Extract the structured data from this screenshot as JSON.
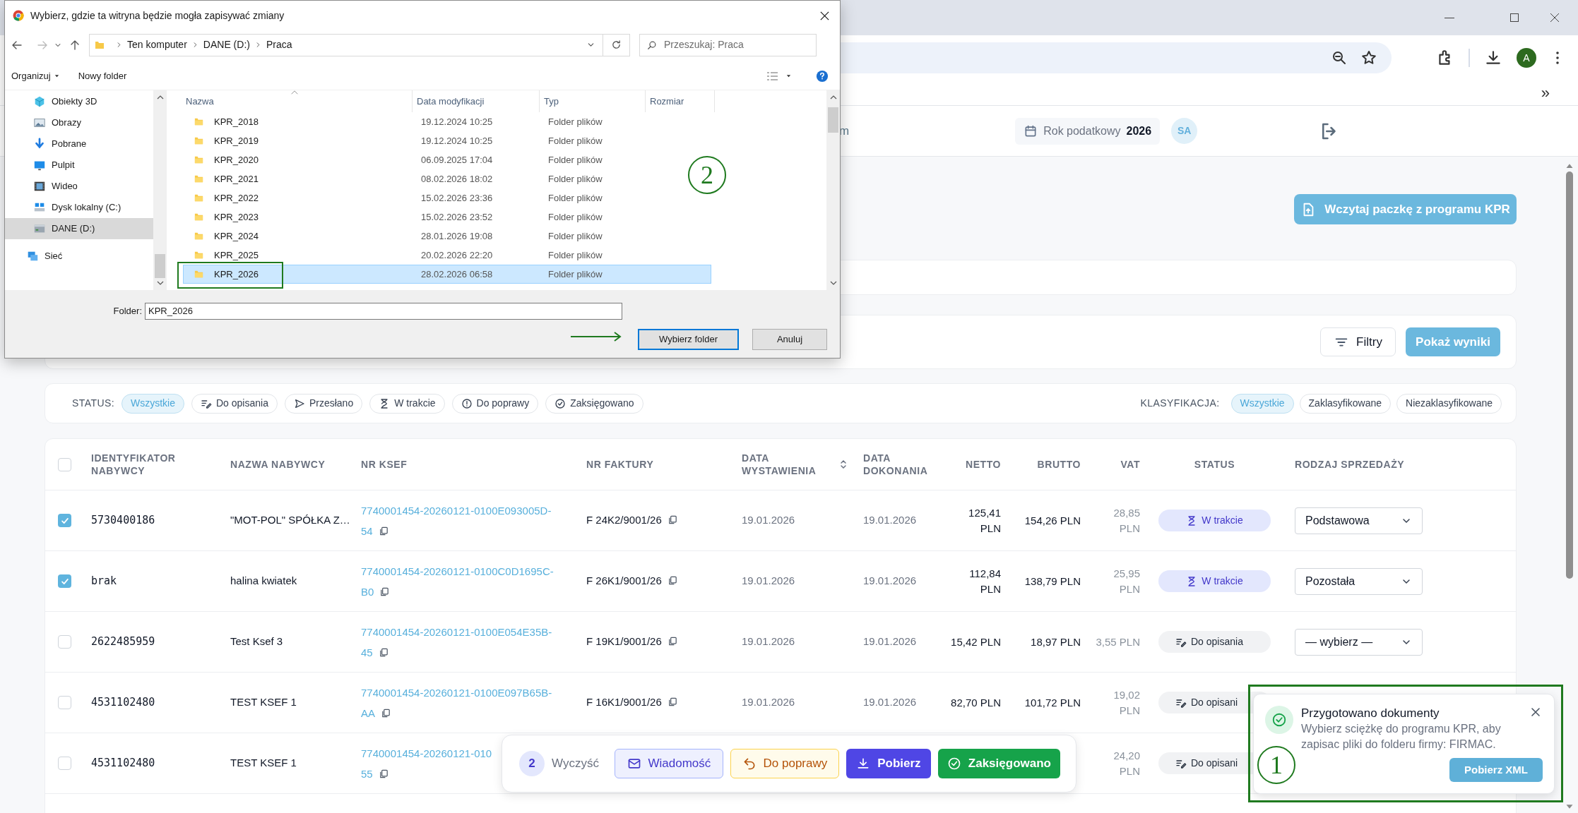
{
  "browser": {
    "profile_initial": "A",
    "bookmarks_overflow": "»"
  },
  "app_header": {
    "nav_fragment": "m",
    "tax_year_label": "Rok podatkowy",
    "tax_year": "2026",
    "user_initials": "SA"
  },
  "import_button": "Wczytaj paczkę z programu KPR",
  "filters": {
    "filters_button": "Filtry",
    "show_results_button": "Pokaż wyniki"
  },
  "status_filter": {
    "label": "STATUS:",
    "chips": [
      {
        "label": "Wszystkie",
        "kind": "all",
        "selected": true
      },
      {
        "label": "Do opisania",
        "kind": "describe",
        "selected": false
      },
      {
        "label": "Przesłano",
        "kind": "sent",
        "selected": false
      },
      {
        "label": "W trakcie",
        "kind": "in_progress",
        "selected": false
      },
      {
        "label": "Do poprawy",
        "kind": "fix",
        "selected": false
      },
      {
        "label": "Zaksięgowano",
        "kind": "booked",
        "selected": false
      }
    ]
  },
  "classification_filter": {
    "label": "KLASYFIKACJA:",
    "chips": [
      {
        "label": "Wszystkie",
        "selected": true
      },
      {
        "label": "Zaklasyfikowane",
        "selected": false
      },
      {
        "label": "Niezaklasyfikowane",
        "selected": false
      }
    ]
  },
  "table": {
    "select_all_checked": false,
    "columns": [
      {
        "label": "IDENTYFIKATOR NABYWCY",
        "sortable": false
      },
      {
        "label": "NAZWA NABYWCY",
        "sortable": false
      },
      {
        "label": "NR KSEF",
        "sortable": false
      },
      {
        "label": "NR FAKTURY",
        "sortable": false
      },
      {
        "label": "DATA WYSTAWIENIA",
        "sortable": true
      },
      {
        "label": "DATA DOKONANIA",
        "sortable": false
      },
      {
        "label": "NETTO",
        "sortable": false
      },
      {
        "label": "BRUTTO",
        "sortable": false
      },
      {
        "label": "VAT",
        "sortable": false
      },
      {
        "label": "STATUS",
        "sortable": false
      },
      {
        "label": "RODZAJ SPRZEDAŻY",
        "sortable": false
      }
    ],
    "rows": [
      {
        "selected": true,
        "buyer_id": "5730400186",
        "buyer_name": "\"MOT-POL\" SPÓŁKA Z…",
        "ksef": [
          "7740001454-20260121-0100E093005D-",
          "54"
        ],
        "invoice_no": "F 24K2/9001/26",
        "issue_date": "19.01.2026",
        "completion_date": "19.01.2026",
        "net": "125,41 PLN",
        "gross": "154,26 PLN",
        "vat": "28,85 PLN",
        "status": {
          "label": "W trakcie",
          "kind": "in_progress"
        },
        "sale_type": "Podstawowa"
      },
      {
        "selected": true,
        "buyer_id": "brak",
        "buyer_name": "halina kwiatek",
        "ksef": [
          "7740001454-20260121-0100C0D1695C-",
          "B0"
        ],
        "invoice_no": "F 26K1/9001/26",
        "issue_date": "19.01.2026",
        "completion_date": "19.01.2026",
        "net": "112,84 PLN",
        "gross": "138,79 PLN",
        "vat": "25,95 PLN",
        "status": {
          "label": "W trakcie",
          "kind": "in_progress"
        },
        "sale_type": "Pozostała"
      },
      {
        "selected": false,
        "buyer_id": "2622485959",
        "buyer_name": "Test Ksef 3",
        "ksef": [
          "7740001454-20260121-0100E054E35B-",
          "45"
        ],
        "invoice_no": "F 19K1/9001/26",
        "issue_date": "19.01.2026",
        "completion_date": "19.01.2026",
        "net": "15,42 PLN",
        "gross": "18,97 PLN",
        "vat": "3,55 PLN",
        "status": {
          "label": "Do opisania",
          "kind": "describe"
        },
        "sale_type": "— wybierz —"
      },
      {
        "selected": false,
        "buyer_id": "4531102480",
        "buyer_name": "TEST KSEF 1",
        "ksef": [
          "7740001454-20260121-0100E097B65B-",
          "AA"
        ],
        "invoice_no": "F 16K1/9001/26",
        "issue_date": "19.01.2026",
        "completion_date": "19.01.2026",
        "net": "82,70 PLN",
        "gross": "101,72 PLN",
        "vat": "19,02 PLN",
        "status": {
          "label": "Do opisani",
          "kind": "describe"
        }
      },
      {
        "selected": false,
        "buyer_id": "4531102480",
        "buyer_name": "TEST KSEF 1",
        "ksef": [
          "7740001454-20260121-010",
          "55"
        ],
        "vat": "24,20 PLN",
        "status": {
          "label": "Do opisani",
          "kind": "describe"
        }
      }
    ]
  },
  "action_bar": {
    "count": "2",
    "clear": "Wyczyść",
    "buttons": [
      {
        "label": "Wiadomość",
        "kind": "message"
      },
      {
        "label": "Do poprawy",
        "kind": "fix"
      },
      {
        "label": "Pobierz",
        "kind": "download"
      },
      {
        "label": "Zaksięgowano",
        "kind": "booked"
      }
    ]
  },
  "toast": {
    "title": "Przygotowano dokumenty",
    "message": "Wybierz sciężkę do programu KPR, aby zapisac pliki do folderu firmy: FIRMAC.",
    "button": "Pobierz XML"
  },
  "dialog": {
    "title": "Wybierz, gdzie ta witryna będzie mogła zapisywać zmiany",
    "path": [
      "Ten komputer",
      "DANE (D:)",
      "Praca"
    ],
    "search_placeholder": "Przeszukaj: Praca",
    "organize": "Organizuj",
    "new_folder": "Nowy folder",
    "nav_items": [
      {
        "label": "Obiekty 3D",
        "kind": "objects3d",
        "selected": false
      },
      {
        "label": "Obrazy",
        "kind": "pictures",
        "selected": false
      },
      {
        "label": "Pobrane",
        "kind": "downloads",
        "selected": false
      },
      {
        "label": "Pulpit",
        "kind": "desktop",
        "selected": false
      },
      {
        "label": "Wideo",
        "kind": "videos",
        "selected": false
      },
      {
        "label": "Dysk lokalny (C:)",
        "kind": "disk",
        "selected": false
      },
      {
        "label": "DANE (D:)",
        "kind": "drive",
        "selected": true
      },
      {
        "label": "Sieć",
        "kind": "network",
        "selected": false
      }
    ],
    "columns": [
      "Nazwa",
      "Data modyfikacji",
      "Typ",
      "Rozmiar"
    ],
    "files": [
      {
        "name": "KPR_2018",
        "modified": "19.12.2024 10:25",
        "type": "Folder plików",
        "selected": false
      },
      {
        "name": "KPR_2019",
        "modified": "19.12.2024 10:25",
        "type": "Folder plików",
        "selected": false
      },
      {
        "name": "KPR_2020",
        "modified": "06.09.2025 17:04",
        "type": "Folder plików",
        "selected": false
      },
      {
        "name": "KPR_2021",
        "modified": "08.02.2026 18:02",
        "type": "Folder plików",
        "selected": false
      },
      {
        "name": "KPR_2022",
        "modified": "15.02.2026 23:36",
        "type": "Folder plików",
        "selected": false
      },
      {
        "name": "KPR_2023",
        "modified": "15.02.2026 23:52",
        "type": "Folder plików",
        "selected": false
      },
      {
        "name": "KPR_2024",
        "modified": "28.01.2026 19:08",
        "type": "Folder plików",
        "selected": false
      },
      {
        "name": "KPR_2025",
        "modified": "20.02.2026 22:20",
        "type": "Folder plików",
        "selected": false
      },
      {
        "name": "KPR_2026",
        "modified": "28.02.2026 06:58",
        "type": "Folder plików",
        "selected": true
      }
    ],
    "folder_label": "Folder:",
    "folder_value": "KPR_2026",
    "confirm_button": "Wybierz folder",
    "cancel_button": "Anuluj"
  },
  "annotations": {
    "dialog_marker": "2",
    "toast_marker": "1"
  }
}
